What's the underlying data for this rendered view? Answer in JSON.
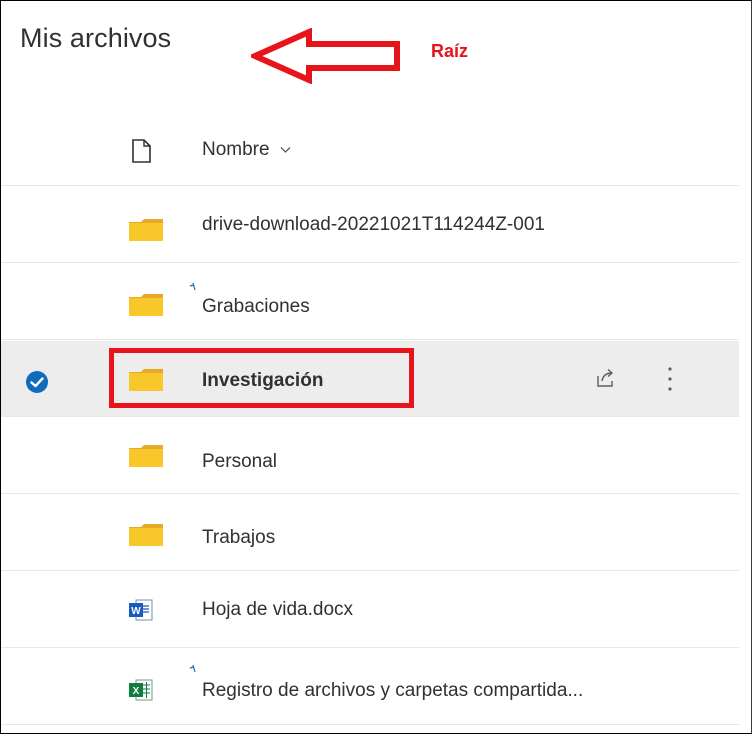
{
  "page": {
    "title": "Mis archivos"
  },
  "annotation": {
    "label": "Raíz",
    "color": "#e8141b"
  },
  "list": {
    "header": {
      "name_label": "Nombre",
      "sort_icon": "chevron-down-icon",
      "type_icon": "document-icon"
    },
    "rows": [
      {
        "name": "drive-download-20221021T114244Z-001",
        "type": "folder",
        "selected": false,
        "recent_sync": false
      },
      {
        "name": "Grabaciones",
        "type": "folder",
        "selected": false,
        "recent_sync": true
      },
      {
        "name": "Investigación",
        "type": "folder",
        "selected": true,
        "recent_sync": false
      },
      {
        "name": "Personal",
        "type": "folder",
        "selected": false,
        "recent_sync": false
      },
      {
        "name": "Trabajos",
        "type": "folder",
        "selected": false,
        "recent_sync": false
      },
      {
        "name": "Hoja de vida.docx",
        "type": "word",
        "selected": false,
        "recent_sync": false
      },
      {
        "name": "Registro de archivos y carpetas compartida...",
        "type": "excel",
        "selected": false,
        "recent_sync": true
      }
    ]
  },
  "colors": {
    "folder": "#f8c82a",
    "folder_dark": "#e7a92a",
    "check": "#0f6cbd",
    "word": "#185abd",
    "excel": "#107c41",
    "selected_bg": "#ededed"
  }
}
